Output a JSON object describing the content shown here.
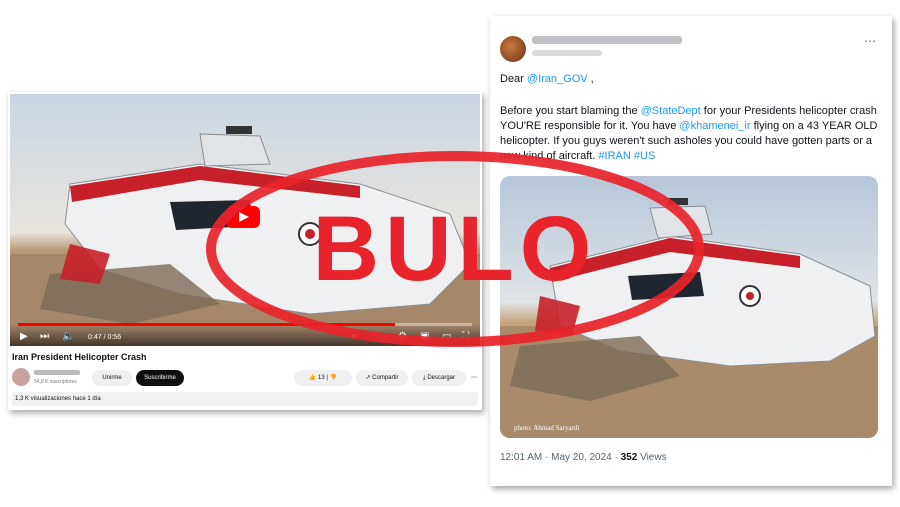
{
  "youtube": {
    "video_time": "0:47 / 0:56",
    "title": "Iran President Helicopter Crash",
    "subscribers": "54,8 K suscriptores",
    "join_label": "Unirme",
    "subscribe_label": "Suscribirme",
    "likes": "13",
    "share_label": "Compartir",
    "download_label": "Descargar",
    "views_date": "1,3 K visualizaciones  hace 1 día",
    "more_icon": "ellipsis-icon"
  },
  "tweet": {
    "greeting_prefix": "Dear ",
    "mention_iran_gov": "@Iran_GOV",
    "greeting_suffix": " ,",
    "body_1": "Before you start blaming the ",
    "mention_statedept": "@StateDept",
    "body_2": " for your Presidents helicopter crash YOU'RE responsible for it. You have ",
    "mention_khamenei": "@khamenei_ir",
    "body_3": " flying on a 43 YEAR OLD helicopter. If you guys weren't such asholes you could have gotten parts or a new kind of aircraft. ",
    "hashtag_iran": "#IRAN",
    "hashtag_us": "#US",
    "photo_credit": "photo: Ahmad Saryardi",
    "time": "12:01 AM · May 20, 2024 · ",
    "views_count": "352",
    "views_label": " Views"
  },
  "stamp": {
    "text": "BULO",
    "color": "#e8232b"
  }
}
